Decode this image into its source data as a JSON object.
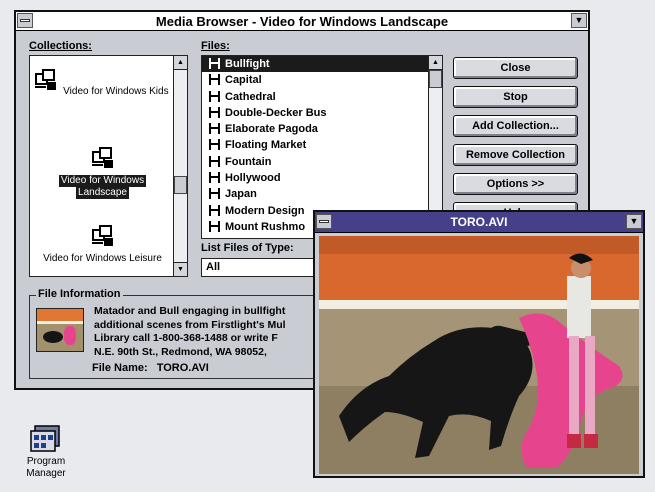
{
  "window": {
    "title": "Media Browser - Video for Windows  Landscape"
  },
  "collections": {
    "label": "Collections:",
    "items": [
      {
        "label": "Video for Windows  Kids",
        "selected": false
      },
      {
        "label_line1": "Video for Windows",
        "label_line2": "Landscape",
        "selected": true
      },
      {
        "label": "Video for Windows  Leisure",
        "selected": false
      }
    ]
  },
  "files": {
    "label": "Files:",
    "items": [
      "Bullfight",
      "Capital",
      "Cathedral",
      "Double-Decker Bus",
      "Elaborate Pagoda",
      "Floating Market",
      "Fountain",
      "Hollywood",
      "Japan",
      "Modern Design",
      "Mount Rushmo"
    ],
    "selected": "Bullfight"
  },
  "file_type": {
    "label": "List Files of Type:",
    "value": "All"
  },
  "buttons": {
    "close": "Close",
    "stop": "Stop",
    "add_collection": "Add Collection...",
    "remove_collection": "Remove Collection",
    "options": "Options >>",
    "help": "Help"
  },
  "file_info": {
    "label": "File Information",
    "lines": [
      "Matador and Bull engaging in bullfight",
      "additional scenes from Firstlight's Mul",
      "Library call 1-800-368-1488 or write F",
      "N.E. 90th St., Redmond, WA  98052,"
    ],
    "file_name_label": "File Name:",
    "file_name": "TORO.AVI"
  },
  "video_window": {
    "title": "TORO.AVI"
  },
  "desktop": {
    "program_manager_line1": "Program",
    "program_manager_line2": "Manager"
  },
  "colors": {
    "selection": "#1b1b1b",
    "arena_wall": "#d8682e",
    "cape": "#e6458e"
  }
}
